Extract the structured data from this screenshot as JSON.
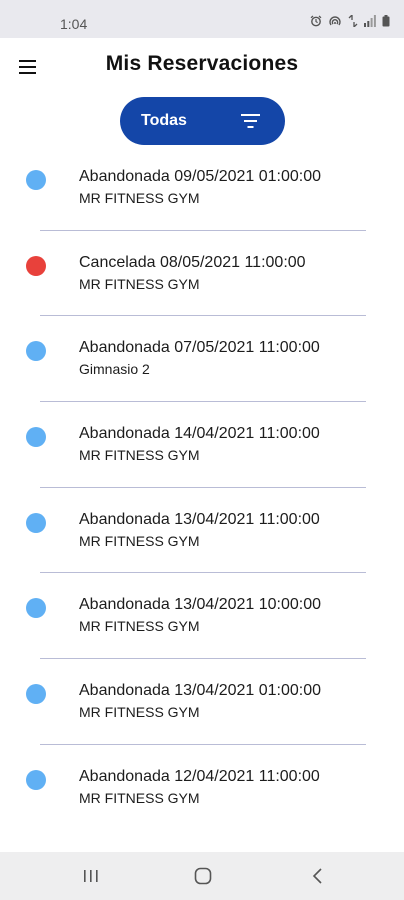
{
  "status_bar": {
    "time": "1:04",
    "icons": [
      "alarm-icon",
      "hotspot-icon",
      "wifi-icon",
      "signal-icon",
      "battery-icon"
    ]
  },
  "header": {
    "title": "Mis Reservaciones",
    "menu_icon": "hamburger-menu-icon"
  },
  "filter": {
    "label": "Todas",
    "icon": "filter-icon",
    "color": "#1446a8"
  },
  "colors": {
    "abandoned_dot": "#60b0f4",
    "cancelled_dot": "#e8413b"
  },
  "reservations": [
    {
      "status": "abandoned",
      "title": "Abandonada 09/05/2021 01:00:00",
      "gym": "MR FITNESS GYM"
    },
    {
      "status": "cancelled",
      "title": "Cancelada 08/05/2021 11:00:00",
      "gym": "MR FITNESS GYM"
    },
    {
      "status": "abandoned",
      "title": "Abandonada 07/05/2021 11:00:00",
      "gym": "Gimnasio 2"
    },
    {
      "status": "abandoned",
      "title": "Abandonada 14/04/2021 11:00:00",
      "gym": "MR FITNESS GYM"
    },
    {
      "status": "abandoned",
      "title": "Abandonada 13/04/2021 11:00:00",
      "gym": "MR FITNESS GYM"
    },
    {
      "status": "abandoned",
      "title": "Abandonada 13/04/2021 10:00:00",
      "gym": "MR FITNESS GYM"
    },
    {
      "status": "abandoned",
      "title": "Abandonada 13/04/2021 01:00:00",
      "gym": "MR FITNESS GYM"
    },
    {
      "status": "abandoned",
      "title": "Abandonada 12/04/2021 11:00:00",
      "gym": "MR FITNESS GYM"
    }
  ],
  "nav_bar": {
    "buttons": [
      "recent-apps-icon",
      "home-icon",
      "back-icon"
    ]
  }
}
